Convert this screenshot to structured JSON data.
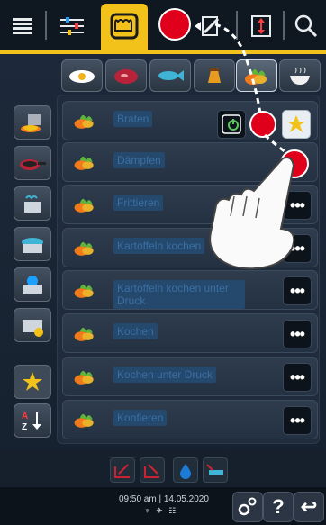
{
  "topbar": {
    "icons": [
      "menu-icon",
      "sliders-icon",
      "chef-hat-icon",
      "mode-dot",
      "edit-icon",
      "split-view-icon",
      "search-icon"
    ]
  },
  "categories": [
    {
      "name": "egg-icon",
      "active": false
    },
    {
      "name": "meat-icon",
      "active": false
    },
    {
      "name": "fish-icon",
      "active": false
    },
    {
      "name": "dessert-icon",
      "active": false
    },
    {
      "name": "vegetable-icon",
      "active": true
    },
    {
      "name": "soup-icon",
      "active": false
    }
  ],
  "sidebar": {
    "items": [
      {
        "name": "side-dish-icon"
      },
      {
        "name": "pan-icon"
      },
      {
        "name": "steamer-pot-icon"
      },
      {
        "name": "pot-lid-icon"
      },
      {
        "name": "pressure-pot-icon"
      },
      {
        "name": "oil-pot-icon"
      }
    ],
    "favorites_icon": "star-icon",
    "sort_label": "A Z"
  },
  "rows": [
    {
      "label": "Braten",
      "show_dots": false
    },
    {
      "label": "Dämpfen",
      "show_dots": false
    },
    {
      "label": "Frittieren",
      "show_dots": true
    },
    {
      "label": "Kartoffeln kochen",
      "show_dots": true
    },
    {
      "label": "Kartoffeln kochen unter Druck",
      "show_dots": true
    },
    {
      "label": "Kochen",
      "show_dots": true
    },
    {
      "label": "Kochen unter Druck",
      "show_dots": true
    },
    {
      "label": "Konfieren",
      "show_dots": true
    }
  ],
  "dots_label": "•••",
  "footer": {
    "time": "09:50 am | 14.05.2020",
    "status": "♆ ✈ ☷",
    "help_label": "?",
    "back_label": "↩"
  },
  "colors": {
    "accent": "#f2c21a",
    "alert": "#e0001b"
  }
}
